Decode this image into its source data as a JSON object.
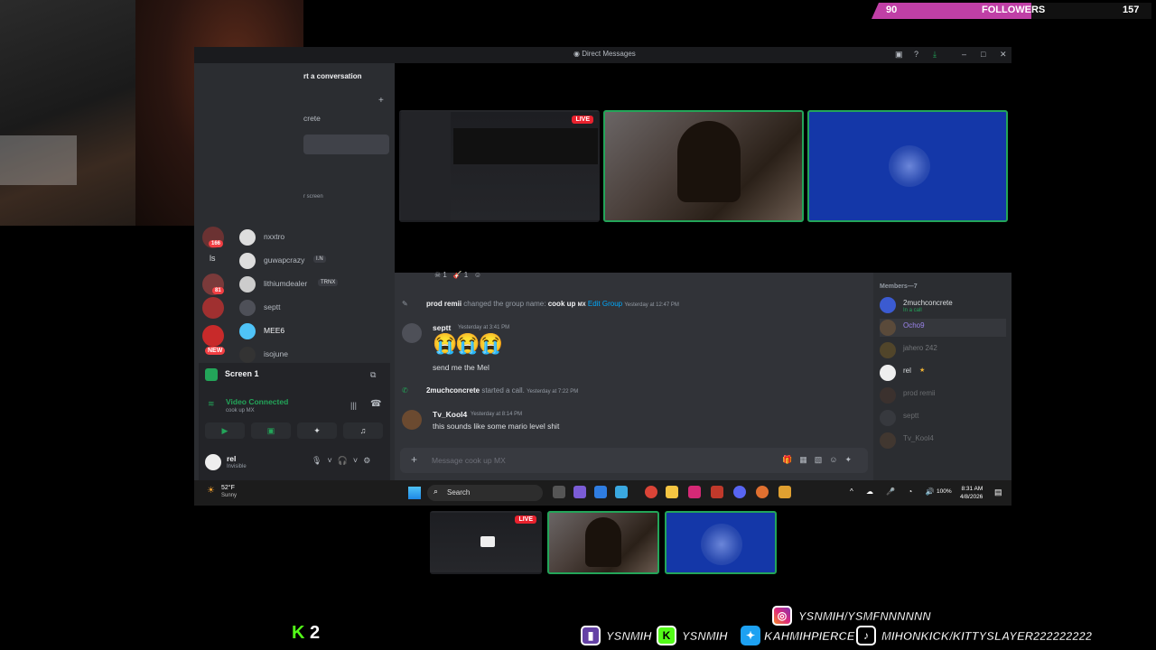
{
  "followers": {
    "count": "90",
    "label": "FOLLOWERS",
    "goal": "157",
    "progress_fraction": 0.57
  },
  "window": {
    "title": "Direct Messages"
  },
  "sidebar": {
    "start_conversation": "rt a conversation",
    "partial_item": "crete",
    "partial_item2": "r screen",
    "dms": [
      {
        "name": "nxxtro"
      },
      {
        "name": "guwapcrazy",
        "tag": "I.N"
      },
      {
        "name": "lithiumdealer",
        "tag": "TRNX"
      },
      {
        "name": "septt"
      },
      {
        "name": "MEE6"
      },
      {
        "name": "isojune"
      }
    ],
    "server_badges": [
      "166",
      "81",
      "NEW"
    ],
    "server_label": "ls"
  },
  "voice": {
    "screen_label": "Screen 1",
    "status": "Video Connected",
    "channel": "cook up MX",
    "user": {
      "name": "rel",
      "status": "Invisible"
    }
  },
  "call": {
    "live_label": "LIVE"
  },
  "chat": {
    "reactions": [
      "1",
      "1"
    ],
    "system1": {
      "actor": "prod remii",
      "action": "changed the group name:",
      "value": "cook up",
      "suffix": "MX",
      "link": "Edit Group",
      "ts": "Yesterday at 12:47 PM"
    },
    "msg1": {
      "author": "septt",
      "ts": "Yesterday at 3:41 PM",
      "emoji": "😭😭😭",
      "text": "send me the Mel"
    },
    "system2": {
      "actor": "2muchconcrete",
      "action": "started a call.",
      "ts": "Yesterday at 7:22 PM"
    },
    "msg2": {
      "author": "Tv_Kool4",
      "ts": "Yesterday at 8:14 PM",
      "text": "this sounds like some mario level shit"
    },
    "placeholder": "Message cook up MX"
  },
  "members": {
    "header": "Members—7",
    "list": [
      {
        "name": "2muchconcrete",
        "sub": "In a call"
      },
      {
        "name": "Ocho9"
      },
      {
        "name": "jahero 242"
      },
      {
        "name": "rel"
      },
      {
        "name": "prod remii"
      },
      {
        "name": "septt"
      },
      {
        "name": "Tv_Kool4"
      }
    ]
  },
  "taskbar": {
    "weather_temp": "52°F",
    "weather_desc": "Sunny",
    "search": "Search",
    "battery": "100%",
    "time": "8:31 AM",
    "date": "4/8/2026"
  },
  "overlay": {
    "kick_count": "2",
    "instagram": "YSNMIH/YSMFNNNNNN",
    "twitch": "YSNMIH",
    "kick": "YSNMIH",
    "twitter": "KAHMIHPIERCE",
    "tiktok": "MIHONKICK/KITTYSLAYER222222222"
  },
  "colors": {
    "accent_green": "#23a559",
    "follower_pink": "#c03fa6",
    "kick_green": "#53fc18",
    "blue_tile": "#1437a8"
  }
}
